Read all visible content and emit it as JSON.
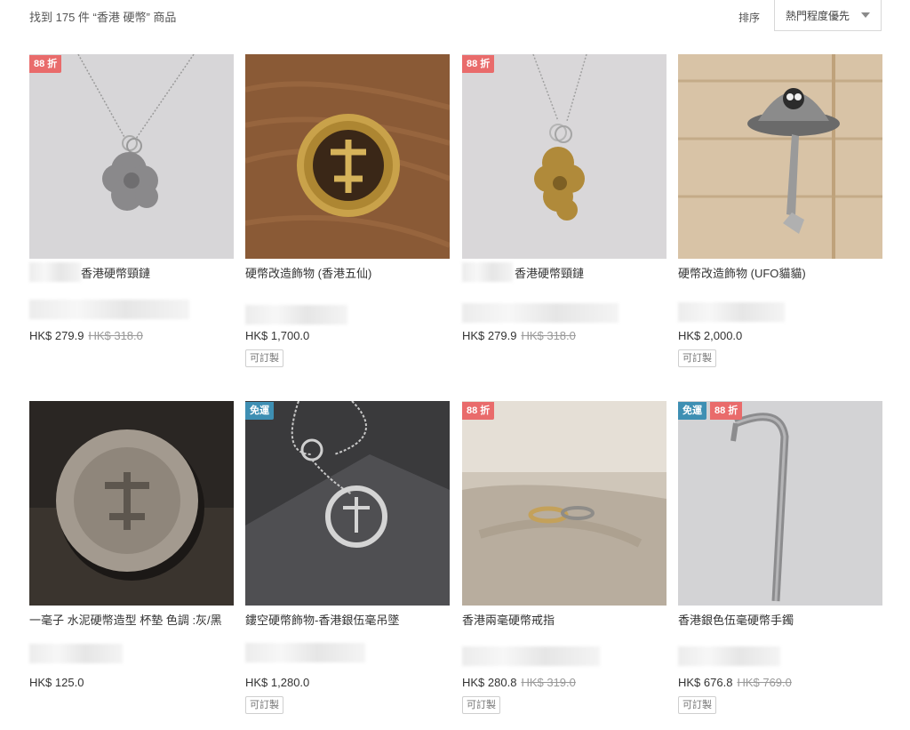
{
  "header": {
    "result_count": "找到 175 件 “香港 硬幣” 商品",
    "sort_label": "排序",
    "sort_value": "熱門程度優先"
  },
  "products": [
    {
      "title": "香港硬幣頸鏈",
      "price": "HK$ 279.9",
      "original_price": "HK$ 318.0",
      "badges": [
        "88 折"
      ],
      "tag": ""
    },
    {
      "title": "硬幣改造飾物 (香港五仙)",
      "price": "HK$ 1,700.0",
      "original_price": "",
      "badges": [],
      "tag": "可訂製"
    },
    {
      "title": "香港硬幣頸鏈",
      "price": "HK$ 279.9",
      "original_price": "HK$ 318.0",
      "badges": [
        "88 折"
      ],
      "tag": ""
    },
    {
      "title": "硬幣改造飾物 (UFO貓貓)",
      "price": "HK$ 2,000.0",
      "original_price": "",
      "badges": [],
      "tag": "可訂製"
    },
    {
      "title": "一毫子 水泥硬幣造型 杯墊 色調 :灰/黑",
      "price": "HK$ 125.0",
      "original_price": "",
      "badges": [],
      "tag": ""
    },
    {
      "title": "鏤空硬幣飾物-香港銀伍毫吊墜",
      "price": "HK$ 1,280.0",
      "original_price": "",
      "badges": [
        "免運"
      ],
      "tag": "可訂製"
    },
    {
      "title": "香港兩毫硬幣戒指",
      "price": "HK$ 280.8",
      "original_price": "HK$ 319.0",
      "badges": [
        "88 折"
      ],
      "tag": "可訂製"
    },
    {
      "title": "香港銀色伍毫硬幣手鐲",
      "price": "HK$ 676.8",
      "original_price": "HK$ 769.0",
      "badges": [
        "免運",
        "88 折"
      ],
      "tag": "可訂製"
    }
  ],
  "colors": {
    "discount_badge": "#e96b6b",
    "shipping_badge": "#3e8fb3"
  }
}
